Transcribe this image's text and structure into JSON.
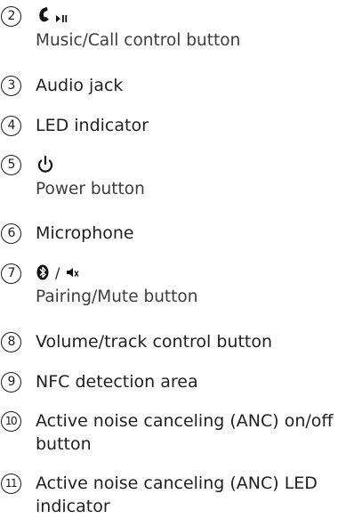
{
  "items": [
    {
      "number": "2",
      "icon": "phone-play-pause-icon",
      "label": "Music/Call control button"
    },
    {
      "number": "3",
      "label": "Audio jack"
    },
    {
      "number": "4",
      "label": "LED indicator"
    },
    {
      "number": "5",
      "icon": "power-icon",
      "label": "Power button"
    },
    {
      "number": "6",
      "label": "Microphone"
    },
    {
      "number": "7",
      "icon": "bluetooth-mute-icon",
      "icon_separator": "/",
      "label": "Pairing/Mute button"
    },
    {
      "number": "8",
      "label": "Volume/track control button"
    },
    {
      "number": "9",
      "label": "NFC detection area"
    },
    {
      "number": "10",
      "label_lines": [
        "Active noise canceling (ANC) on/off",
        "button"
      ]
    },
    {
      "number": "11",
      "label_lines": [
        "Active noise canceling (ANC) LED",
        "indicator"
      ]
    }
  ]
}
